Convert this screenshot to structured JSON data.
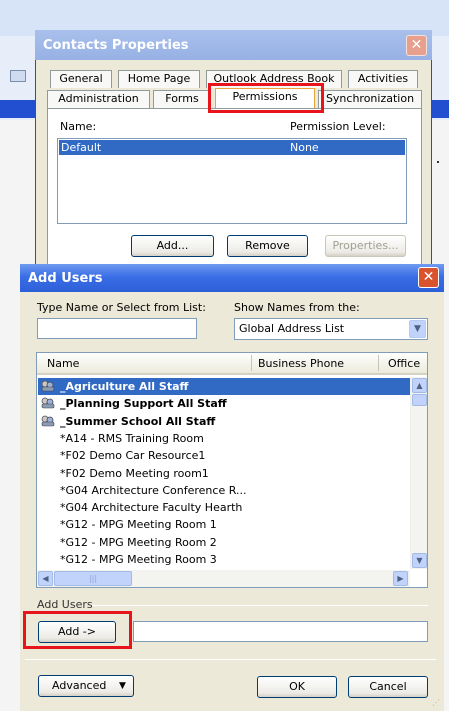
{
  "contacts_properties": {
    "title": "Contacts Properties",
    "tabs_row1": [
      "General",
      "Home Page",
      "Outlook Address Book",
      "Activities"
    ],
    "tabs_row2": [
      "Administration",
      "Forms",
      "Permissions",
      "Synchronization"
    ],
    "active_tab": "Permissions",
    "name_header": "Name:",
    "permission_header": "Permission Level:",
    "entries": [
      {
        "name": "Default",
        "level": "None"
      }
    ],
    "add_label": "Add...",
    "remove_label": "Remove",
    "properties_label": "Properties..."
  },
  "add_users": {
    "title": "Add Users",
    "type_name_label": "Type Name or Select from List:",
    "type_name_value": "",
    "show_names_label": "Show Names from the:",
    "show_names_value": "Global Address List",
    "columns": [
      "Name",
      "Business Phone",
      "Office"
    ],
    "rows": [
      {
        "name": "_Agriculture All Staff",
        "group": true,
        "selected": true
      },
      {
        "name": "_Planning Support All Staff",
        "group": true
      },
      {
        "name": "_Summer School All Staff",
        "group": true
      },
      {
        "name": "*A14 - RMS Training Room"
      },
      {
        "name": "*F02 Demo Car Resource1"
      },
      {
        "name": "*F02 Demo Meeting room1"
      },
      {
        "name": "*G04 Architecture Conference R..."
      },
      {
        "name": "*G04 Architecture Faculty Hearth"
      },
      {
        "name": "*G12 - MPG Meeting Room 1"
      },
      {
        "name": "*G12 - MPG Meeting Room 2"
      },
      {
        "name": "*G12 - MPG Meeting Room 3"
      }
    ],
    "add_users_section": "Add Users",
    "add_button": "Add ->",
    "add_users_value": "",
    "advanced_label": "Advanced",
    "ok_label": "OK",
    "cancel_label": "Cancel"
  },
  "colors": {
    "title_blue": "#2d5fd9",
    "selection": "#316ac5",
    "highlight_box": "#e8141b"
  }
}
